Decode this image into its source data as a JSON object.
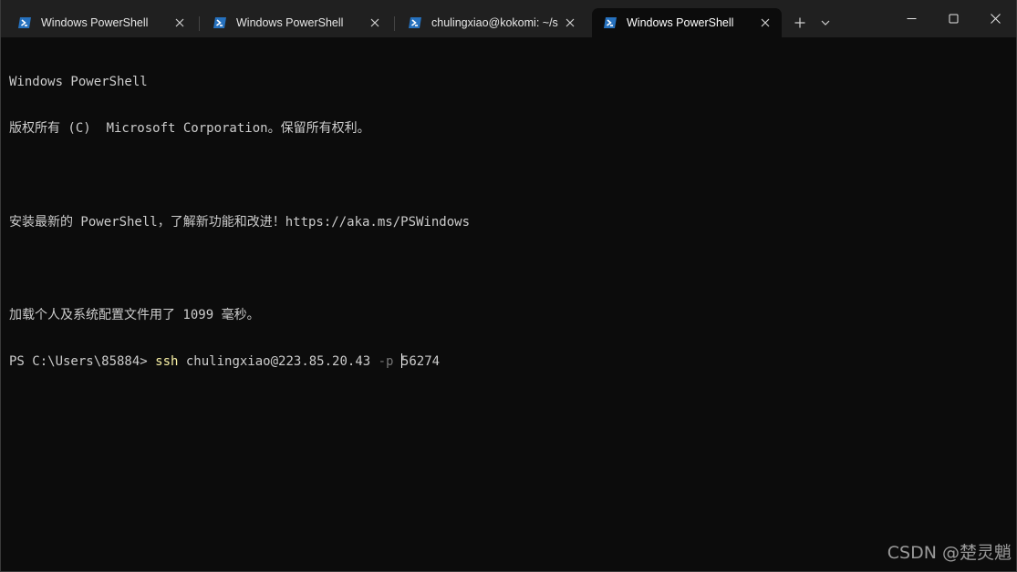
{
  "tabs": [
    {
      "title": "Windows PowerShell",
      "active": false,
      "icon": "powershell-icon"
    },
    {
      "title": "Windows PowerShell",
      "active": false,
      "icon": "powershell-icon"
    },
    {
      "title": "chulingxiao@kokomi: ~/s",
      "active": false,
      "icon": "powershell-icon"
    },
    {
      "title": "Windows PowerShell",
      "active": true,
      "icon": "powershell-icon"
    }
  ],
  "terminal": {
    "line1": "Windows PowerShell",
    "line2": "版权所有 (C)  Microsoft Corporation。保留所有权利。",
    "line3": "",
    "line4": "安装最新的 PowerShell，了解新功能和改进！https://aka.ms/PSWindows",
    "line5": "",
    "line6": "加载个人及系统配置文件用了 1099 毫秒。",
    "prompt": "PS C:\\Users\\85884> ",
    "cmd": "ssh",
    "args": " chulingxiao@223.85.20.43 ",
    "flag": "-p",
    "space": " ",
    "port": "56274"
  },
  "watermark": "CSDN @楚灵魈",
  "colors": {
    "background": "#0c0c0c",
    "titlebar": "#202020",
    "command": "#f9f1a5",
    "flag": "#767676",
    "text": "#cccccc"
  }
}
